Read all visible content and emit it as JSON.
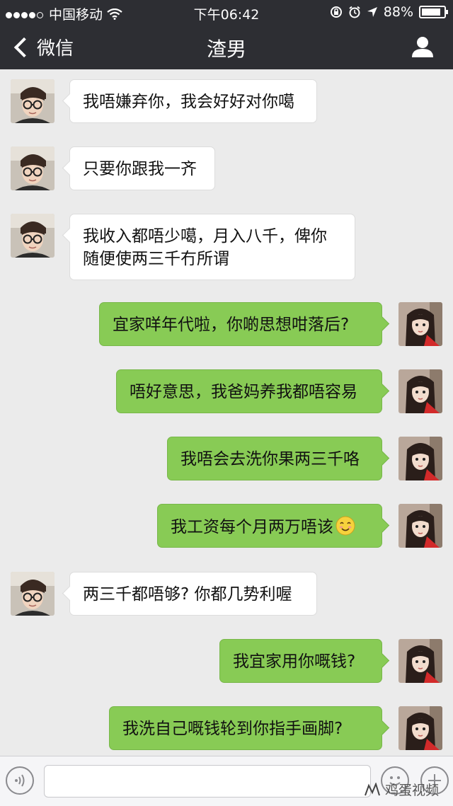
{
  "status_bar": {
    "carrier": "中国移动",
    "time": "下午06:42",
    "battery": "88%",
    "battery_level": 0.88
  },
  "nav": {
    "back_label": "微信",
    "title": "渣男"
  },
  "messages": [
    {
      "side": "left",
      "text": "我唔嫌弃你，我会好好对你噶"
    },
    {
      "side": "left",
      "text": "只要你跟我一齐"
    },
    {
      "side": "left",
      "text": "我收入都唔少噶，月入八千，俾你\n随便使两三千冇所谓"
    },
    {
      "side": "right",
      "text": "宜家咩年代啦，你啲思想咁落后?"
    },
    {
      "side": "right",
      "text": "唔好意思，我爸妈养我都唔容易"
    },
    {
      "side": "right",
      "text": "我唔会去洗你果两三千咯"
    },
    {
      "side": "right",
      "text": "我工资每个月两万唔该",
      "emoji": "smiley-emoji"
    },
    {
      "side": "left",
      "text": "两三千都唔够? 你都几势利喔"
    },
    {
      "side": "right",
      "text": "我宜家用你嘅钱?"
    },
    {
      "side": "right",
      "text": "我洗自己嘅钱轮到你指手画脚?"
    }
  ],
  "input": {
    "value": "",
    "placeholder": ""
  },
  "watermark": "鸡蛋视频",
  "colors": {
    "header_bg": "#2d2e33",
    "chat_bg": "#ebebeb",
    "sent_bubble": "#88cb55",
    "received_bubble": "#ffffff"
  },
  "icons": [
    "wifi-icon",
    "lock-rotation-icon",
    "alarm-icon",
    "location-icon",
    "back-chevron-icon",
    "profile-icon",
    "voice-icon",
    "emoji-icon",
    "plus-icon",
    "smiley-emoji",
    "watermark-logo"
  ]
}
